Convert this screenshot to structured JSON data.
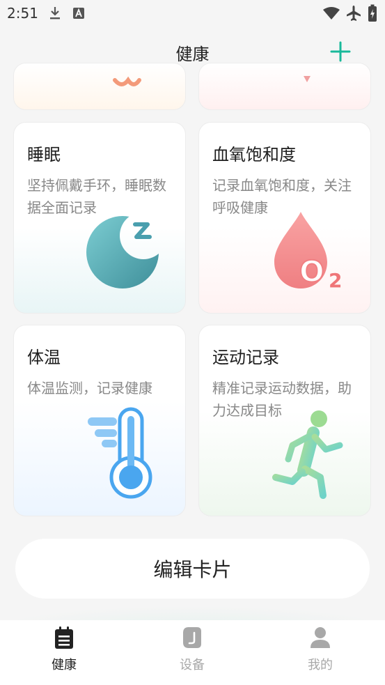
{
  "status_bar": {
    "time": "2:51"
  },
  "header": {
    "title": "健康"
  },
  "cards": {
    "sleep": {
      "title": "睡眠",
      "description": "坚持佩戴手环，睡眠数据全面记录"
    },
    "spo2": {
      "title": "血氧饱和度",
      "description": "记录血氧饱和度，关注呼吸健康",
      "icon_text": "O",
      "icon_sub": "2"
    },
    "temperature": {
      "title": "体温",
      "description": "体温监测，记录健康"
    },
    "exercise": {
      "title": "运动记录",
      "description": "精准记录运动数据，助力达成目标"
    }
  },
  "edit_button": {
    "label": "编辑卡片"
  },
  "tab_bar": {
    "tabs": [
      {
        "label": "健康",
        "icon": "health-clipboard-icon",
        "active": true
      },
      {
        "label": "设备",
        "icon": "watch-icon",
        "active": false
      },
      {
        "label": "我的",
        "icon": "person-icon",
        "active": false
      }
    ]
  },
  "colors": {
    "accent": "#19b99a",
    "active_tab": "#222222",
    "inactive_tab": "#a8a8a8"
  }
}
